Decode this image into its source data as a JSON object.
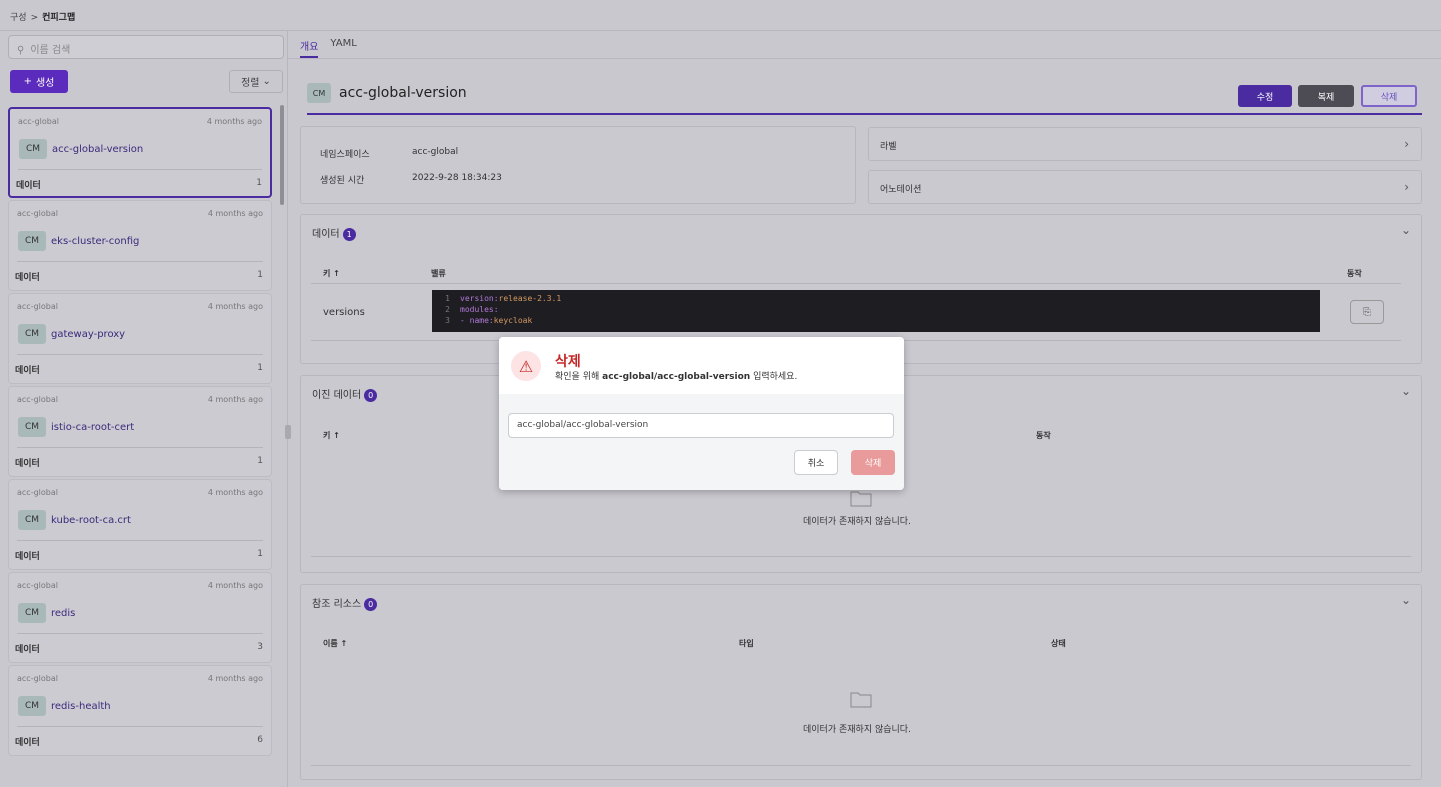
{
  "breadcrumb": {
    "parent": "구성",
    "separator": ">",
    "current": "컨피그맵"
  },
  "sidebar": {
    "search_placeholder": "이름 검색",
    "create_label": "생성",
    "sort_label": "정렬",
    "items": [
      {
        "namespace": "acc-global",
        "age": "4 months ago",
        "kind": "CM",
        "name": "acc-global-version",
        "data_label": "데이터",
        "data_count": "1"
      },
      {
        "namespace": "acc-global",
        "age": "4 months ago",
        "kind": "CM",
        "name": "eks-cluster-config",
        "data_label": "데이터",
        "data_count": "1"
      },
      {
        "namespace": "acc-global",
        "age": "4 months ago",
        "kind": "CM",
        "name": "gateway-proxy",
        "data_label": "데이터",
        "data_count": "1"
      },
      {
        "namespace": "acc-global",
        "age": "4 months ago",
        "kind": "CM",
        "name": "istio-ca-root-cert",
        "data_label": "데이터",
        "data_count": "1"
      },
      {
        "namespace": "acc-global",
        "age": "4 months ago",
        "kind": "CM",
        "name": "kube-root-ca.crt",
        "data_label": "데이터",
        "data_count": "1"
      },
      {
        "namespace": "acc-global",
        "age": "4 months ago",
        "kind": "CM",
        "name": "redis",
        "data_label": "데이터",
        "data_count": "3"
      },
      {
        "namespace": "acc-global",
        "age": "4 months ago",
        "kind": "CM",
        "name": "redis-health",
        "data_label": "데이터",
        "data_count": "6"
      }
    ]
  },
  "tabs": {
    "overview": "개요",
    "yaml": "YAML"
  },
  "detail": {
    "kind": "CM",
    "title": "acc-global-version",
    "edit_label": "수정",
    "copy_label": "복제",
    "delete_label": "삭제",
    "namespace_label": "네임스페이스",
    "namespace_value": "acc-global",
    "created_label": "생성된 시간",
    "created_value": "2022-9-28 18:34:23",
    "labels_label": "라벨",
    "annotations_label": "어노테이션"
  },
  "data_section": {
    "title": "데이터",
    "count": "1",
    "col_key": "키 ↑",
    "col_value": "밸류",
    "col_action": "동작",
    "row_key": "versions",
    "code": [
      {
        "no": "1",
        "key": "version",
        "sep": ": ",
        "val": "release-2.3.1"
      },
      {
        "no": "2",
        "key": "modules",
        "sep": ":",
        "val": ""
      },
      {
        "no": "3",
        "key": "- name",
        "sep": ": ",
        "val": "keycloak"
      }
    ]
  },
  "binary_section": {
    "title": "이진 데이터",
    "count": "0",
    "col_key": "키 ↑",
    "col_action": "동작",
    "empty": "데이터가 존재하지 않습니다."
  },
  "refs_section": {
    "title": "참조 리소스",
    "count": "0",
    "col_name": "이름 ↑",
    "col_type": "타입",
    "col_status": "상태",
    "empty": "데이터가 존재하지 않습니다."
  },
  "modal": {
    "title": "삭제",
    "prefix": "확인을 위해",
    "target": "acc-global/acc-global-version",
    "suffix": "입력하세요.",
    "input_value": "acc-global/acc-global-version",
    "cancel_label": "취소",
    "delete_label": "삭제"
  },
  "colors": {
    "accent": "#4a2ba0",
    "danger": "#c62828",
    "delete_disabled": "#e99a9a"
  }
}
